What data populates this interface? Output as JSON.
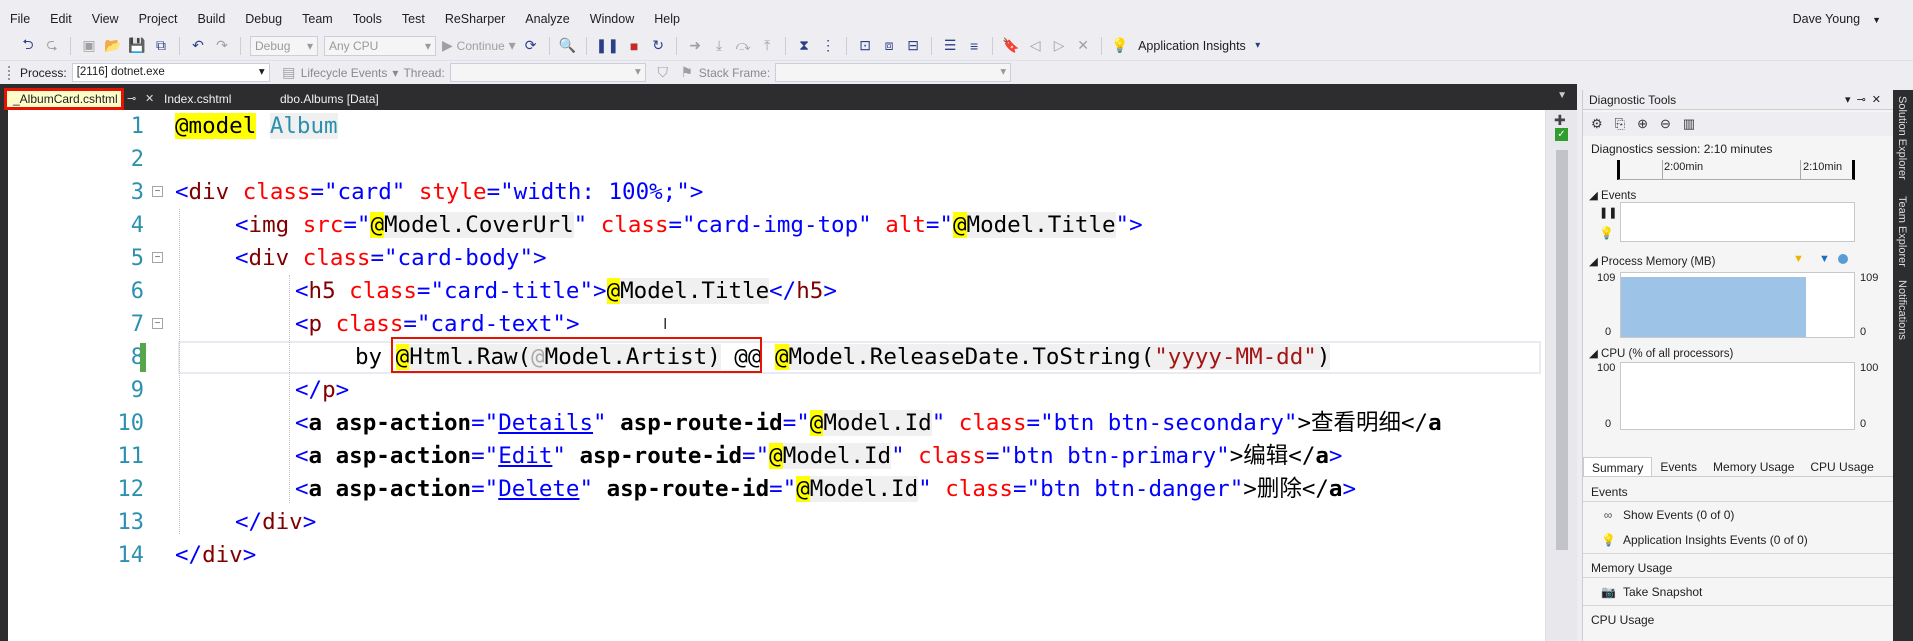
{
  "menu": [
    "File",
    "Edit",
    "View",
    "Project",
    "Build",
    "Debug",
    "Team",
    "Tools",
    "Test",
    "ReSharper",
    "Analyze",
    "Window",
    "Help"
  ],
  "user": {
    "name": "Dave Young"
  },
  "toolbar": {
    "config": "Debug",
    "platform": "Any CPU",
    "continue": "Continue",
    "app_insights": "Application Insights"
  },
  "debugbar": {
    "process_label": "Process:",
    "process_value": "[2116] dotnet.exe",
    "lifecycle": "Lifecycle Events",
    "thread_label": "Thread:",
    "stack_label": "Stack Frame:"
  },
  "tabs": [
    {
      "label": "_AlbumCard.cshtml"
    },
    {
      "label": "Index.cshtml"
    },
    {
      "label": "dbo.Albums [Data]"
    }
  ],
  "editor": {
    "line_numbers": [
      "1",
      "2",
      "3",
      "4",
      "5",
      "6",
      "7",
      "8",
      "9",
      "10",
      "11",
      "12",
      "13",
      "14"
    ],
    "lines": {
      "l1a": "@",
      "l1b": "model",
      "l1c": " ",
      "l1d": "Album",
      "l3a": "<",
      "l3b": "div",
      "l3c": " class",
      "l3d": "=",
      "l3e": "\"card\"",
      "l3f": " style",
      "l3g": "=",
      "l3h": "\"width: 100%;\"",
      "l3i": ">",
      "l4a": "<",
      "l4b": "img",
      "l4c": " src",
      "l4d": "=\"",
      "l4e": "@",
      "l4f": "Model.CoverUrl",
      "l4g": "\"",
      "l4h": " class",
      "l4i": "=",
      "l4j": "\"card-img-top\"",
      "l4k": " alt",
      "l4l": "=\"",
      "l4m": "@",
      "l4n": "Model.Title",
      "l4o": "\"",
      "l4p": ">",
      "l5a": "<",
      "l5b": "div",
      "l5c": " class",
      "l5d": "=",
      "l5e": "\"card-body\"",
      "l5f": ">",
      "l6a": "<",
      "l6b": "h5",
      "l6c": " class",
      "l6d": "=",
      "l6e": "\"card-title\"",
      "l6f": ">",
      "l6g": "@",
      "l6h": "Model.Title",
      "l6i": "</",
      "l6j": "h5",
      "l6k": ">",
      "l7a": "<",
      "l7b": "p",
      "l7c": " class",
      "l7d": "=",
      "l7e": "\"card-text\"",
      "l7f": ">",
      "l8a": "by ",
      "l8b": "@",
      "l8c": "Html.Raw(",
      "l8d": "@",
      "l8e": "Model.Artist)",
      "l8f": " @@ ",
      "l8g": "@",
      "l8h": "Model.ReleaseDate.ToString(",
      "l8i": "\"yyyy-MM-dd\"",
      "l8j": ")",
      "l9a": "</",
      "l9b": "p",
      "l9c": ">",
      "l10a": "<",
      "l10b": "a",
      "l10c": " asp-action",
      "l10d": "=\"",
      "l10e": "Details",
      "l10f": "\"",
      "l10g": " asp-route-id",
      "l10h": "=\"",
      "l10i": "@",
      "l10j": "Model.Id",
      "l10k": "\"",
      "l10l": " class",
      "l10m": "=",
      "l10n": "\"btn btn-secondary\"",
      "l10o": ">查看明细</",
      "l10p": "a",
      "l11a": "<",
      "l11b": "a",
      "l11c": " asp-action",
      "l11d": "=\"",
      "l11e": "Edit",
      "l11f": "\"",
      "l11g": " asp-route-id",
      "l11h": "=\"",
      "l11i": "@",
      "l11j": "Model.Id",
      "l11k": "\"",
      "l11l": " class",
      "l11m": "=",
      "l11n": "\"btn btn-primary\"",
      "l11o": ">编辑</",
      "l11p": "a",
      "l11q": ">",
      "l12a": "<",
      "l12b": "a",
      "l12c": " asp-action",
      "l12d": "=\"",
      "l12e": "Delete",
      "l12f": "\"",
      "l12g": " asp-route-id",
      "l12h": "=\"",
      "l12i": "@",
      "l12j": "Model.Id",
      "l12k": "\"",
      "l12l": " class",
      "l12m": "=",
      "l12n": "\"btn btn-danger\"",
      "l12o": ">删除</",
      "l12p": "a",
      "l12q": ">",
      "l13a": "</",
      "l13b": "div",
      "l13c": ">",
      "l14a": "</",
      "l14b": "div",
      "l14c": ">"
    }
  },
  "diagnostics": {
    "title": "Diagnostic Tools",
    "session": "Diagnostics session: 2:10 minutes",
    "tick1": "2:00min",
    "tick2": "2:10min",
    "events": "Events",
    "process_memory": "Process Memory (MB)",
    "mem_max": "109",
    "mem_min": "0",
    "cpu": "CPU (% of all processors)",
    "cpu_max": "100",
    "cpu_min": "0",
    "tabs": [
      "Summary",
      "Events",
      "Memory Usage",
      "CPU Usage"
    ],
    "summary_events": "Events",
    "show_events": "Show Events (0 of 0)",
    "ai_events": "Application Insights Events (0 of 0)",
    "memory_usage": "Memory Usage",
    "take_snapshot": "Take Snapshot",
    "cpu_usage": "CPU Usage"
  },
  "side_tabs": [
    "Solution Explorer",
    "Team Explorer",
    "Notifications"
  ]
}
